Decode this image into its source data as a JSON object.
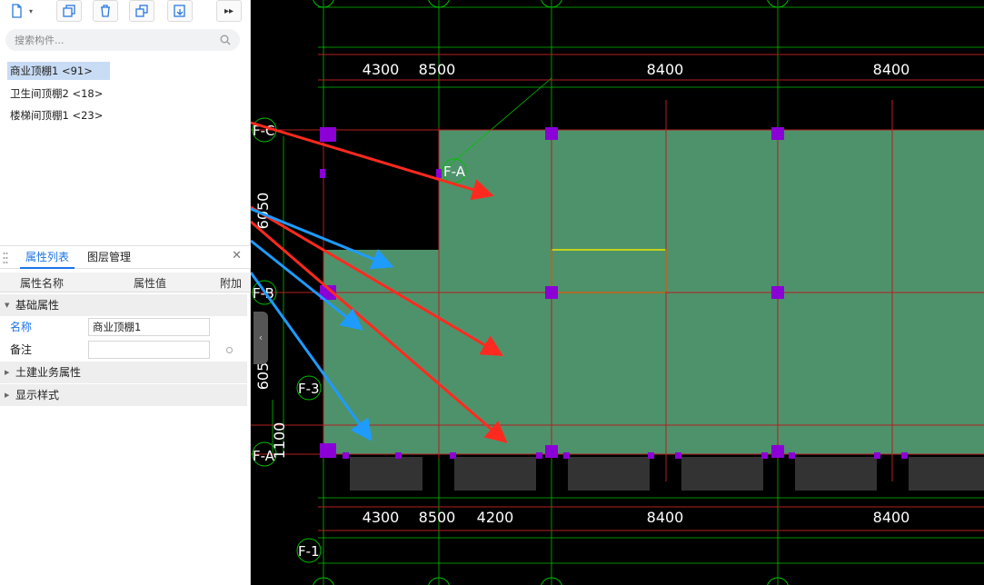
{
  "toolbar": {
    "buttons": [
      {
        "name": "new-component-button",
        "icon": "new-file-icon"
      },
      {
        "name": "copy-component-button",
        "icon": "copy-icon"
      },
      {
        "name": "delete-component-button",
        "icon": "trash-icon"
      },
      {
        "name": "duplicate-button",
        "icon": "duplicate-icon"
      },
      {
        "name": "import-button",
        "icon": "import-icon"
      },
      {
        "name": "more-button",
        "icon": "double-chevron-right-icon"
      }
    ]
  },
  "search": {
    "placeholder": "搜索构件..."
  },
  "components": [
    {
      "label": "商业顶棚1 <91>",
      "selected": true
    },
    {
      "label": "卫生间顶棚2 <18>",
      "selected": false
    },
    {
      "label": "楼梯间顶棚1 <23>",
      "selected": false
    }
  ],
  "panel": {
    "tabs": [
      "属性列表",
      "图层管理"
    ],
    "close": "✕",
    "columns": {
      "name": "属性名称",
      "value": "属性值",
      "extra": "附加"
    },
    "groups": {
      "basic": "基础属性",
      "civil": "土建业务属性",
      "display": "显示样式"
    },
    "props": {
      "name_label": "名称",
      "name_value": "商业顶棚1",
      "note_label": "备注",
      "note_value": ""
    }
  },
  "drawing": {
    "grid_labels": {
      "fc": "F-C",
      "fb": "F-B",
      "fa_left": "F-A",
      "fa_inner": "F-A",
      "f3": "F-3",
      "f1": "F-1"
    },
    "top_dims": [
      "4300",
      "8500",
      "8400",
      "8400"
    ],
    "bottom_dims": [
      "4300",
      "8500",
      "4200",
      "8400",
      "8400"
    ],
    "vertical_dims": [
      "6050",
      "605",
      "1100"
    ],
    "colors": {
      "slab": "#4e926b",
      "axis": "#00c000",
      "beam": "#b32020",
      "column": "#8a00d6",
      "wall": "#333333",
      "highlight": "#e8e800",
      "arrow_red": "#ff2a1f",
      "arrow_blue": "#1e9bff"
    }
  }
}
